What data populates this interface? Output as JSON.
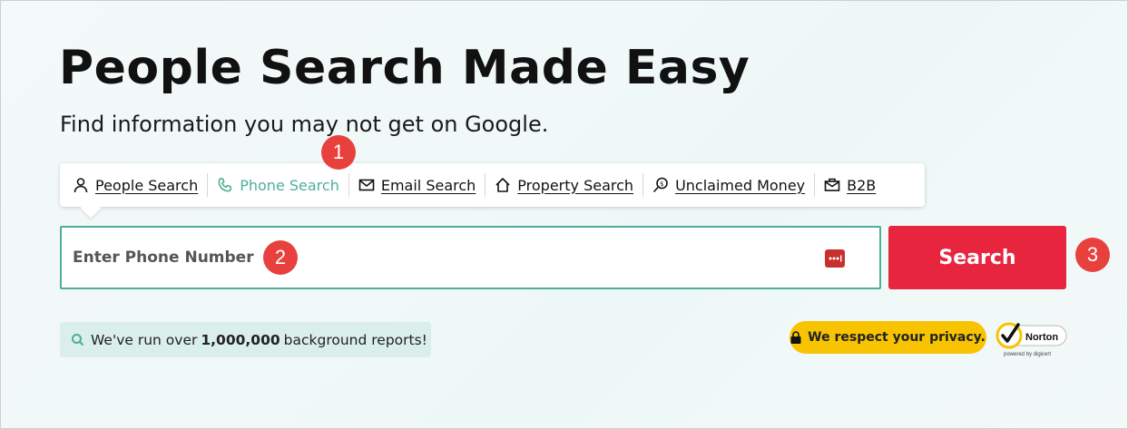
{
  "hero": {
    "title": "People Search Made Easy",
    "subtitle": "Find information you may not get on Google."
  },
  "tabs": [
    {
      "label": "People Search",
      "icon": "person-icon",
      "active": false
    },
    {
      "label": "Phone Search",
      "icon": "phone-icon",
      "active": true
    },
    {
      "label": "Email Search",
      "icon": "envelope-icon",
      "active": false
    },
    {
      "label": "Property Search",
      "icon": "house-icon",
      "active": false
    },
    {
      "label": "Unclaimed Money",
      "icon": "magnifier-dollar-icon",
      "active": false
    },
    {
      "label": "B2B",
      "icon": "briefcase-mail-icon",
      "active": false
    }
  ],
  "search": {
    "placeholder": "Enter Phone Number",
    "value": "",
    "button_label": "Search"
  },
  "stats": {
    "prefix": "We've run over",
    "count": "1,000,000",
    "suffix": "background reports!"
  },
  "privacy": {
    "label": "We respect your privacy."
  },
  "norton": {
    "brand": "Norton",
    "sub": "powered by digicert"
  },
  "annotations": [
    "1",
    "2",
    "3"
  ],
  "colors": {
    "accent": "#4fae98",
    "search_button": "#e8253f",
    "badge": "#e8413d",
    "privacy_bg": "#f8c300",
    "stats_bg": "#daeeec"
  }
}
